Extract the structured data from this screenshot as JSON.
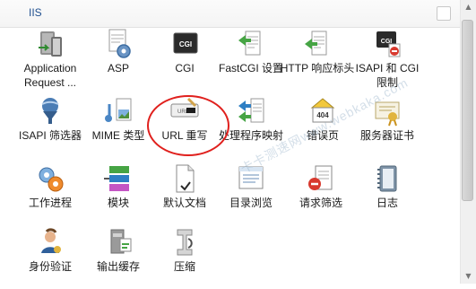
{
  "section": {
    "title": "IIS"
  },
  "items": [
    {
      "label": "Application Request ...",
      "icon": "application-request-routing-icon"
    },
    {
      "label": "ASP",
      "icon": "asp-icon"
    },
    {
      "label": "CGI",
      "icon": "cgi-icon"
    },
    {
      "label": "FastCGI 设置",
      "icon": "fastcgi-icon"
    },
    {
      "label": "HTTP 响应标头",
      "icon": "http-response-headers-icon"
    },
    {
      "label": "ISAPI 和 CGI 限制",
      "icon": "isapi-cgi-restrictions-icon"
    },
    {
      "label": "ISAPI 筛选器",
      "icon": "isapi-filters-icon"
    },
    {
      "label": "MIME 类型",
      "icon": "mime-types-icon"
    },
    {
      "label": "URL 重写",
      "icon": "url-rewrite-icon"
    },
    {
      "label": "处理程序映射",
      "icon": "handler-mappings-icon"
    },
    {
      "label": "错误页",
      "icon": "error-pages-icon"
    },
    {
      "label": "服务器证书",
      "icon": "server-certificates-icon"
    },
    {
      "label": "工作进程",
      "icon": "worker-processes-icon"
    },
    {
      "label": "模块",
      "icon": "modules-icon"
    },
    {
      "label": "默认文档",
      "icon": "default-document-icon"
    },
    {
      "label": "目录浏览",
      "icon": "directory-browsing-icon"
    },
    {
      "label": "请求筛选",
      "icon": "request-filtering-icon"
    },
    {
      "label": "日志",
      "icon": "logging-icon"
    },
    {
      "label": "身份验证",
      "icon": "authentication-icon"
    },
    {
      "label": "输出缓存",
      "icon": "output-caching-icon"
    },
    {
      "label": "压缩",
      "icon": "compression-icon"
    }
  ],
  "watermark": "卡卡测速网www.webkaka.com",
  "colors": {
    "accent": "#1f4f8f",
    "highlight": "#e0201d"
  }
}
